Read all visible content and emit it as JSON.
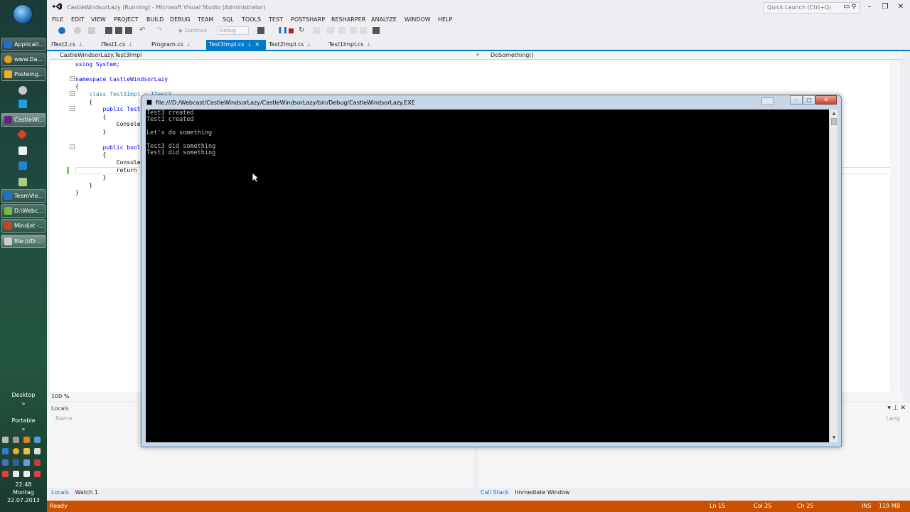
{
  "taskbar": {
    "buttons": [
      {
        "label": "Applicati...",
        "color": "#1e6fd0"
      },
      {
        "label": "www.Da...",
        "color": "#e6a117"
      },
      {
        "label": "Posteing...",
        "color": "#f0b020"
      },
      {
        "label": "CastleWi...",
        "color": "#68217a"
      },
      {
        "label": "TeamVie...",
        "color": "#1e6fd0"
      },
      {
        "label": "D:\\Webc...",
        "color": "#7ab648"
      },
      {
        "label": "Mindjet -...",
        "color": "#d04020"
      },
      {
        "label": "file:///D:...",
        "color": "#cccccc"
      }
    ],
    "desktop_label": "Desktop",
    "portable_label": "Portable",
    "clock": {
      "time": "22:48",
      "day": "Montag",
      "date": "22.07.2013"
    }
  },
  "vs": {
    "title": "CastleWindsorLazy (Running) - Microsoft Visual Studio (Administrator)",
    "quick_launch_placeholder": "Quick Launch (Ctrl+Q)",
    "menu": [
      "FILE",
      "EDIT",
      "VIEW",
      "PROJECT",
      "BUILD",
      "DEBUG",
      "TEAM",
      "SQL",
      "TOOLS",
      "TEST",
      "POSTSHARP",
      "RESHARPER",
      "ANALYZE",
      "WINDOW",
      "HELP"
    ],
    "toolbar": {
      "continue_label": "Continue",
      "config": "Debug"
    },
    "tabs": [
      {
        "label": "ITest2.cs",
        "active": false
      },
      {
        "label": "ITest1.cs",
        "active": false
      },
      {
        "label": "Program.cs",
        "active": false
      },
      {
        "label": "Test3Impl.cs",
        "active": true
      },
      {
        "label": "Test2Impl.cs",
        "active": false
      },
      {
        "label": "Test1Impl.cs",
        "active": false
      }
    ],
    "nav_left": "CastleWindsorLazy.Test3Impl",
    "nav_right": "DoSomething()",
    "code": [
      "using System;",
      "",
      "namespace CastleWindsorLazy",
      "{",
      "    class Test3Impl : ITest3",
      "    {",
      "        public Test",
      "        {",
      "            Console.",
      "        }",
      "",
      "        public bool",
      "        {",
      "            Console.",
      "            return t",
      "        }",
      "    }",
      "}"
    ],
    "zoom": "100 %",
    "locals_title": "Locals",
    "locals_col_name": "Name",
    "right_col": "Lang",
    "bottom_tabs_left": [
      "Locals",
      "Watch 1"
    ],
    "bottom_tabs_right": [
      "Call Stack",
      "Immediate Window"
    ],
    "status": {
      "ready": "Ready",
      "ln": "Ln 15",
      "col": "Col 25",
      "ch": "Ch 25",
      "ins": "INS",
      "mem": "119 MB"
    }
  },
  "console": {
    "title": "file:///D:/Webcast/CastleWindsorLazy/CastleWindsorLazy/bin/Debug/CastleWindsorLazy.EXE",
    "output": "Test3 created\nTest1 created\n\nLet's do something\n\nTest3 did something\nTest1 did something"
  },
  "colors": {
    "accent": "#007acc",
    "status_bar": "#ca5100"
  }
}
